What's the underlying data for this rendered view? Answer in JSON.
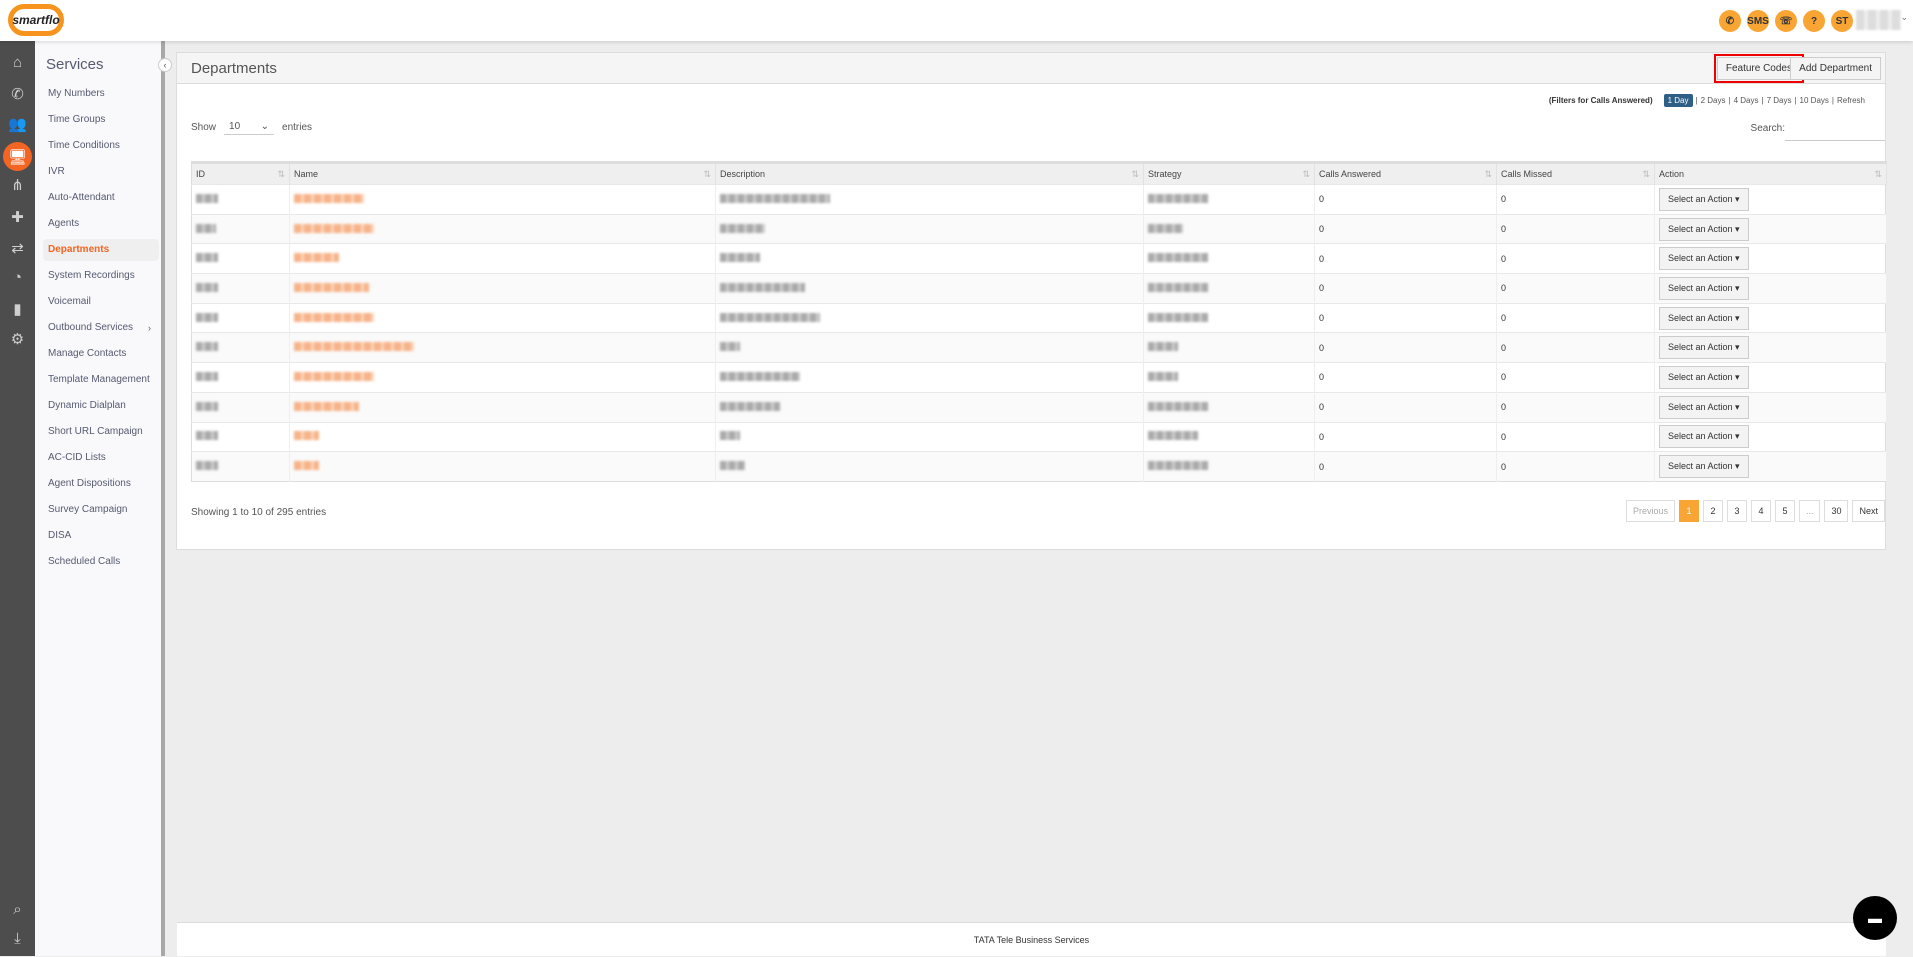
{
  "header": {
    "logo_text": "smartflo",
    "icons": [
      {
        "name": "call-icon",
        "glyph": "✆"
      },
      {
        "name": "sms-icon",
        "glyph": "SMS"
      },
      {
        "name": "call-history-icon",
        "glyph": "☏"
      },
      {
        "name": "help-icon",
        "glyph": "?"
      }
    ],
    "avatar": "ST"
  },
  "rail": [
    {
      "name": "home-icon",
      "glyph": "⌂"
    },
    {
      "name": "phone-icon",
      "glyph": "✆"
    },
    {
      "name": "users-icon",
      "glyph": "👥"
    },
    {
      "name": "services-icon",
      "glyph": "🖥",
      "active": true
    },
    {
      "name": "network-icon",
      "glyph": "⋔"
    },
    {
      "name": "integrations-icon",
      "glyph": "✚"
    },
    {
      "name": "routing-icon",
      "glyph": "⇄"
    },
    {
      "name": "pie-chart-icon",
      "glyph": "◔"
    },
    {
      "name": "bar-chart-icon",
      "glyph": "▮"
    },
    {
      "name": "gear-icon",
      "glyph": "⚙"
    }
  ],
  "rail_bottom": [
    {
      "name": "search-icon",
      "glyph": "⌕"
    },
    {
      "name": "download-icon",
      "glyph": "⤓"
    }
  ],
  "sidebar": {
    "title": "Services",
    "active": "Departments",
    "items": [
      "My Numbers",
      "Time Groups",
      "Time Conditions",
      "IVR",
      "Auto-Attendant",
      "Agents",
      "Departments",
      "System Recordings",
      "Voicemail",
      "Outbound Services",
      "Manage Contacts",
      "Template Management",
      "Dynamic Dialplan",
      "Short URL Campaign",
      "AC-CID Lists",
      "Agent Dispositions",
      "Survey Campaign",
      "DISA",
      "Scheduled Calls"
    ]
  },
  "panel": {
    "title": "Departments",
    "feature_codes": "Feature Codes",
    "add_department": "Add Department",
    "filters_label": "(Filters for Calls Answered)",
    "filters": [
      "1 Day",
      "2 Days",
      "4 Days",
      "7 Days",
      "10 Days",
      "Refresh"
    ],
    "active_filter": "1 Day",
    "show": "Show",
    "entries": "entries",
    "page_size": "10",
    "search_label": "Search:",
    "search_value": ""
  },
  "table": {
    "columns": [
      "ID",
      "Name",
      "Description",
      "Strategy",
      "Calls Answered",
      "Calls Missed",
      "Action"
    ],
    "rows": [
      {
        "answered": "0",
        "missed": "0",
        "action": "Select an Action"
      },
      {
        "answered": "0",
        "missed": "0",
        "action": "Select an Action"
      },
      {
        "answered": "0",
        "missed": "0",
        "action": "Select an Action"
      },
      {
        "answered": "0",
        "missed": "0",
        "action": "Select an Action"
      },
      {
        "answered": "0",
        "missed": "0",
        "action": "Select an Action"
      },
      {
        "answered": "0",
        "missed": "0",
        "action": "Select an Action"
      },
      {
        "answered": "0",
        "missed": "0",
        "action": "Select an Action"
      },
      {
        "answered": "0",
        "missed": "0",
        "action": "Select an Action"
      },
      {
        "answered": "0",
        "missed": "0",
        "action": "Select an Action"
      },
      {
        "answered": "0",
        "missed": "0",
        "action": "Select an Action"
      }
    ]
  },
  "info": "Showing 1 to 10 of 295 entries",
  "pagination": [
    "Previous",
    "1",
    "2",
    "3",
    "4",
    "5",
    "...",
    "30",
    "Next"
  ],
  "current_page": "1",
  "footer": "TATA Tele Business Services",
  "colors": {
    "accent": "#f26522",
    "orange": "#f9a534",
    "filter_active": "#2e5f86"
  }
}
